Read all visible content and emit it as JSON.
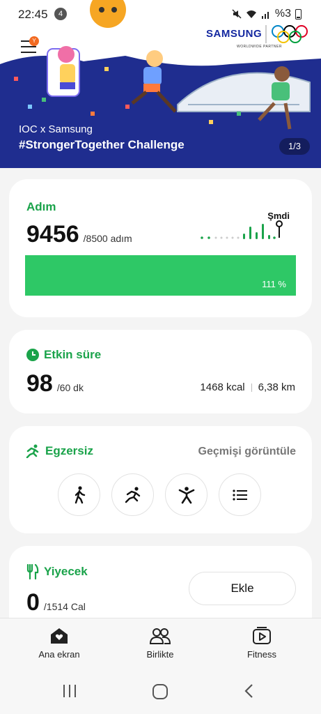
{
  "status_bar": {
    "time": "22:45",
    "notification_count": "4",
    "battery": "%3"
  },
  "banner": {
    "brand": "SAMSUNG",
    "partner": "WORLDWIDE PARTNER",
    "subtitle": "IOC x Samsung",
    "title": "#StrongerTogether Challenge",
    "pager": "1/3",
    "menu_badge": "Y"
  },
  "steps": {
    "label": "Adım",
    "value": "9456",
    "goal": "/8500 adım",
    "now_label": "Şmdi",
    "percent_label": "111 %",
    "percent": 1.11
  },
  "active_time": {
    "label": "Etkin süre",
    "value": "98",
    "goal": "/60 dk",
    "kcal": "1468 kcal",
    "distance": "6,38 km"
  },
  "exercise": {
    "label": "Egzersiz",
    "history_link": "Geçmişi görüntüle",
    "buttons": [
      "walk-icon",
      "run-icon",
      "workout-icon",
      "list-icon"
    ]
  },
  "food": {
    "label": "Yiyecek",
    "value": "0",
    "goal": "/1514 Cal",
    "add_button": "Ekle"
  },
  "bottom_nav": {
    "home": "Ana ekran",
    "together": "Birlikte",
    "fitness": "Fitness"
  },
  "colors": {
    "accent_green": "#1aa34a",
    "progress_green": "#2ec866",
    "banner_blue": "#1f2d8f"
  }
}
